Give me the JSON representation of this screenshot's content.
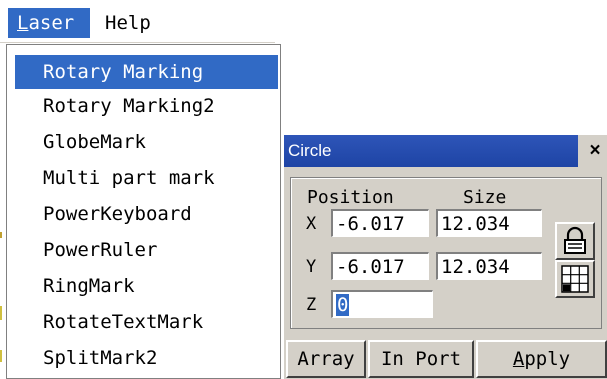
{
  "menubar": {
    "items": [
      {
        "label_first": "L",
        "label_rest": "aser"
      },
      {
        "label": "Help"
      }
    ]
  },
  "laser_menu": {
    "items": [
      {
        "label": "Rotary Marking",
        "selected": true
      },
      {
        "label": "Rotary Marking2"
      },
      {
        "label": "GlobeMark"
      },
      {
        "label": "Multi part mark"
      },
      {
        "label": "PowerKeyboard"
      },
      {
        "label": "PowerRuler"
      },
      {
        "label": "RingMark"
      },
      {
        "label": "RotateTextMark"
      },
      {
        "label": "SplitMark2"
      }
    ]
  },
  "circle_panel": {
    "title": "Circle",
    "close_symbol": "×",
    "headers": {
      "position": "Position",
      "size": "Size"
    },
    "x": {
      "axis": "X",
      "position": "-6.017",
      "size": "12.034"
    },
    "y": {
      "axis": "Y",
      "position": "-6.017",
      "size": "12.034"
    },
    "z": {
      "axis": "Z",
      "value": "0"
    },
    "icons": {
      "lock": "lock-icon",
      "grid": "grid-icon"
    },
    "buttons": {
      "array": "Array",
      "import": "In Port",
      "apply_first": "A",
      "apply_rest": "pply"
    }
  },
  "colors": {
    "selection": "#316ac5",
    "title_bar": "#1e44a5",
    "panel_bg": "#d4d0c8"
  }
}
